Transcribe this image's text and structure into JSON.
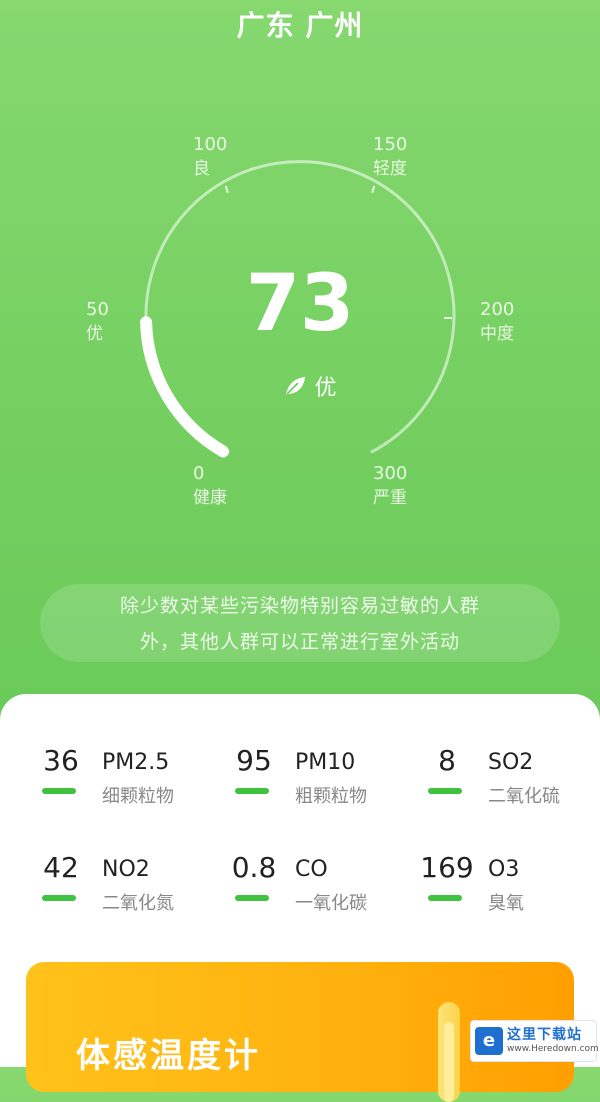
{
  "header": {
    "location": "广东 广州"
  },
  "gauge": {
    "value": "73",
    "level": "优",
    "min": 0,
    "max": 300,
    "scale": [
      {
        "num": "0",
        "label": "健康"
      },
      {
        "num": "50",
        "label": "优"
      },
      {
        "num": "100",
        "label": "良"
      },
      {
        "num": "150",
        "label": "轻度"
      },
      {
        "num": "200",
        "label": "中度"
      },
      {
        "num": "300",
        "label": "严重"
      }
    ]
  },
  "advice": {
    "line1": "除少数对某些污染物特别容易过敏的人群",
    "line2": "外，其他人群可以正常进行室外活动"
  },
  "pollutants": [
    {
      "value": "36",
      "code": "PM2.5",
      "name": "细颗粒物"
    },
    {
      "value": "95",
      "code": "PM10",
      "name": "粗颗粒物"
    },
    {
      "value": "8",
      "code": "SO2",
      "name": "二氧化硫"
    },
    {
      "value": "42",
      "code": "NO2",
      "name": "二氧化氮"
    },
    {
      "value": "0.8",
      "code": "CO",
      "name": "一氧化碳"
    },
    {
      "value": "169",
      "code": "O3",
      "name": "臭氧"
    }
  ],
  "banner": {
    "title": "体感温度计"
  },
  "watermark": {
    "text": "这里下载站",
    "url": "www.Heredown.com"
  },
  "colors": {
    "primary_green": "#6fcd5c",
    "bar_green": "#3fc23f",
    "banner_orange": "#ffb10e"
  }
}
